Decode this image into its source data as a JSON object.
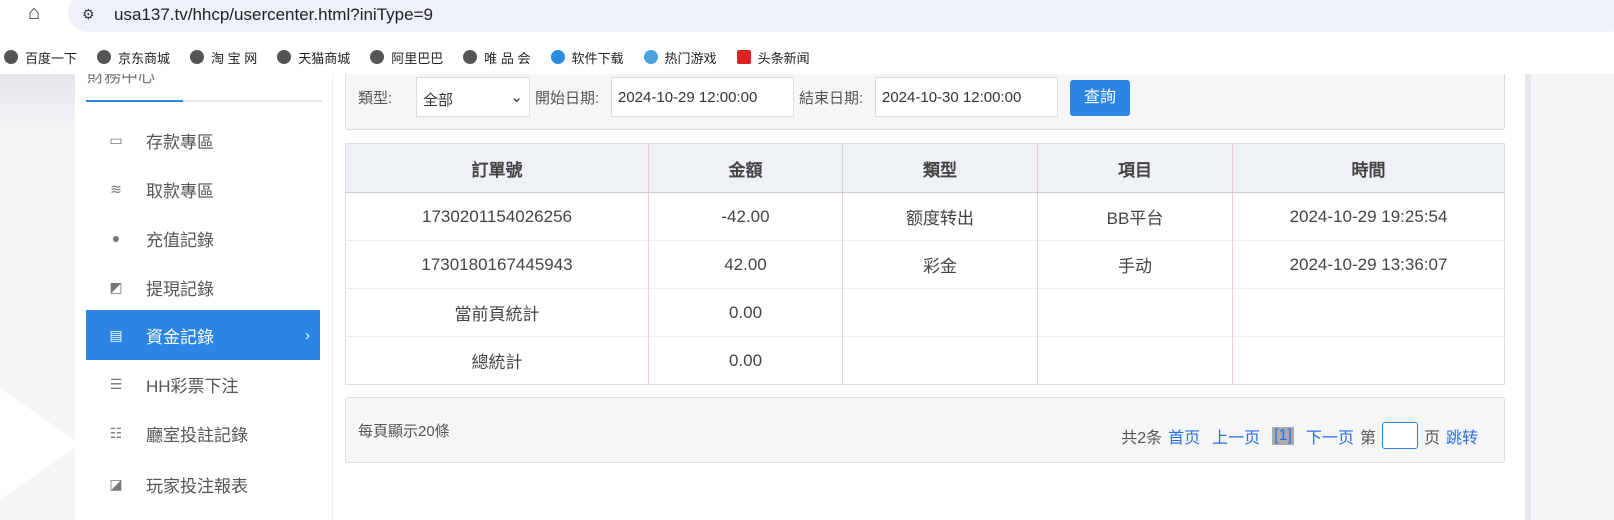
{
  "browser": {
    "url": "usa137.tv/hhcp/usercenter.html?iniType=9",
    "bookmarks": [
      "百度一下",
      "京东商城",
      "淘 宝 网",
      "天猫商城",
      "阿里巴巴",
      "唯 品 会",
      "软件下载",
      "热门游戏",
      "头条新闻"
    ]
  },
  "sidebar": {
    "title": "財務中心",
    "items": [
      {
        "label": "存款專區",
        "icon": "card-icon"
      },
      {
        "label": "取款專區",
        "icon": "hand-cash-icon"
      },
      {
        "label": "充值記錄",
        "icon": "money-bag-icon"
      },
      {
        "label": "提現記錄",
        "icon": "wallet-icon"
      },
      {
        "label": "資金記錄",
        "icon": "funds-icon",
        "active": true
      },
      {
        "label": "HH彩票下注",
        "icon": "list-icon"
      },
      {
        "label": "廳室投註記錄",
        "icon": "list-bullets-icon"
      },
      {
        "label": "玩家投注報表",
        "icon": "chart-icon"
      }
    ]
  },
  "filter": {
    "type_label": "類型:",
    "type_value": "全部",
    "start_label": "開始日期:",
    "start_value": "2024-10-29 12:00:00",
    "end_label": "結束日期:",
    "end_value": "2024-10-30 12:00:00",
    "query_button": "查詢"
  },
  "table": {
    "headers": [
      "訂單號",
      "金額",
      "類型",
      "項目",
      "時間"
    ],
    "rows": [
      [
        "1730201154026256",
        "-42.00",
        "额度转出",
        "BB平台",
        "2024-10-29 19:25:54"
      ],
      [
        "1730180167445943",
        "42.00",
        "彩金",
        "手动",
        "2024-10-29 13:36:07"
      ],
      [
        "當前頁統計",
        "0.00",
        "",
        "",
        ""
      ],
      [
        "總統計",
        "0.00",
        "",
        "",
        ""
      ]
    ]
  },
  "pager": {
    "per_page": "每頁顯示20條",
    "total": "共2条",
    "first": "首页",
    "prev": "上一页",
    "current": "[1]",
    "next": "下一页",
    "page_prefix": "第",
    "page_suffix": "页",
    "jump": "跳转"
  },
  "colors": {
    "accent": "#2b85e4"
  }
}
